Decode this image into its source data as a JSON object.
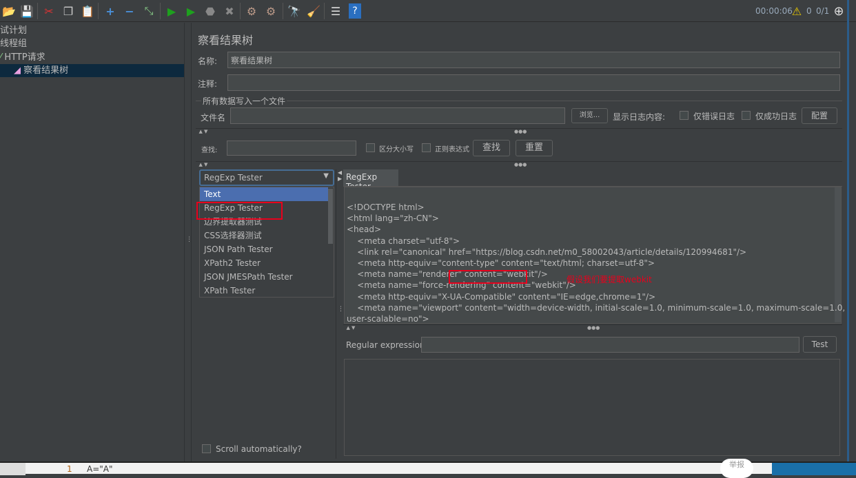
{
  "toolbar": {
    "icons": [
      "open-icon",
      "save-icon",
      "cut-icon",
      "copy-icon",
      "paste-icon",
      "expand-icon",
      "collapse-icon",
      "toggle-icon",
      "start-icon",
      "start-no-pause-icon",
      "stop-icon",
      "shutdown-icon",
      "clear-icon",
      "clear-all-icon",
      "search-icon",
      "reset-search-icon",
      "function-helper-icon",
      "help-icon"
    ],
    "timer": "00:00:06",
    "warnings": "0",
    "threads": "0/1"
  },
  "tree": {
    "items": [
      {
        "label": "试计划"
      },
      {
        "label": "线程组"
      },
      {
        "label": "HTTP请求"
      },
      {
        "label": "察看结果树"
      }
    ]
  },
  "panel": {
    "title": "察看结果树",
    "name_label": "名称:",
    "name_value": "察看结果树",
    "comment_label": "注释:",
    "comment_value": "",
    "file_section": "所有数据写入一个文件",
    "file_label": "文件名",
    "file_value": "",
    "browse": "浏览...",
    "log_label": "显示日志内容:",
    "errors_only": "仅错误日志",
    "success_only": "仅成功日志",
    "configure": "配置",
    "search_label": "查找:",
    "search_value": "",
    "case_sensitive": "区分大小写",
    "regex": "正则表达式",
    "find": "查找",
    "reset": "重置"
  },
  "renderer": {
    "selected": "RegExp Tester",
    "options": [
      "Text",
      "RegExp Tester",
      "边界提取器测试",
      "CSS选择器测试",
      "JSON Path Tester",
      "XPath2 Tester",
      "JSON JMESPath Tester",
      "XPath Tester"
    ],
    "scroll_auto": "Scroll automatically?"
  },
  "tester": {
    "tab": "RegExp Tester",
    "response_lines": [
      "<!DOCTYPE html>",
      "<html lang=\"zh-CN\">",
      "<head>",
      "    <meta charset=\"utf-8\">",
      "    <link rel=\"canonical\" href=\"https://blog.csdn.net/m0_58002043/article/details/120994681\"/>",
      "    <meta http-equiv=\"content-type\" content=\"text/html; charset=utf-8\">",
      "    <meta name=\"renderer\" content=\"webkit\"/>",
      "    <meta name=\"force-rendering\" content=\"webkit\"/>",
      "    <meta http-equiv=\"X-UA-Compatible\" content=\"IE=edge,chrome=1\"/>",
      "    <meta name=\"viewport\" content=\"width=device-width, initial-scale=1.0, minimum-scale=1.0, maximum-scale=1.0,",
      "user-scalable=no\">"
    ],
    "annotation": "假设我们要提取webkit",
    "regex_label": "Regular expression:",
    "regex_value": "",
    "test": "Test"
  },
  "bottom": {
    "line_number": "1",
    "code": "A=\"A\"",
    "report": "举报"
  },
  "colors": {
    "accent": "#4b6eaf",
    "annotation": "#e8001c",
    "selection": "#0d293e"
  }
}
